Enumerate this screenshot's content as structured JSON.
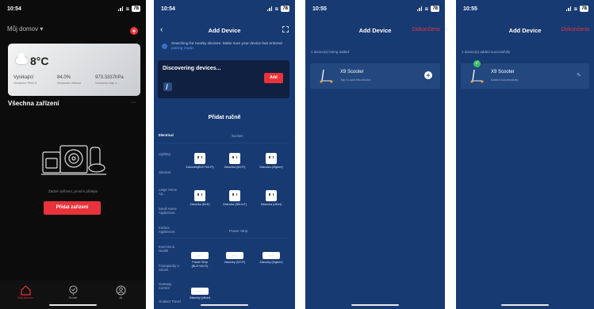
{
  "phone1": {
    "status": {
      "time": "10:54",
      "battery": "78"
    },
    "home_name": "Můj domov",
    "weather": {
      "temp": "8°C",
      "cols": [
        {
          "value": "Vynikající",
          "label": "Venkovní PM2.5"
        },
        {
          "value": "84.0%",
          "label": "Venkovní vlhkost"
        },
        {
          "value": "973.3337hPa",
          "label": "Venkovní tlak v..."
        }
      ]
    },
    "devices_title": "Všechna zařízení",
    "more": "···",
    "empty_msg": "Žádné zařízení, prosím přidejte",
    "add_button": "Přidat zařízení",
    "tabs": [
      {
        "label": "Můj domov",
        "icon": "home-icon",
        "active": true
      },
      {
        "label": "Smart",
        "icon": "smart-icon",
        "active": false
      },
      {
        "label": "Já",
        "icon": "profile-icon",
        "active": false
      }
    ]
  },
  "phone2": {
    "status": {
      "time": "10:54",
      "battery": "78"
    },
    "title": "Add Device",
    "search_msg_pre": "Searching for nearby devices. Make sure your device has entered ",
    "search_msg_link": "pairing mode.",
    "discover_title": "Discovering devices...",
    "discover_add": "Add",
    "manual_title": "Přidat ručně",
    "categories": [
      "Electrical",
      "Lighting",
      "Sensors",
      "Large Home Ap...",
      "Small Home Appliances",
      "Kitchen Appliances",
      "Exercise & Health",
      "Fotoaparáty a zámek",
      "Gateway Control",
      "Outdoor Travel"
    ],
    "section_socket": "Socket",
    "section_power_strip": "Power Strip",
    "socket_products": [
      "Zásuvka(BLE+Wi-Fi)",
      "Zásuvka (Wi-Fi)",
      "Zásuvka (Zigbee)",
      "Zásuvka (BLE)",
      "Zásuvka (NB-IoT)",
      "Zásuvka (other)"
    ],
    "strip_products": [
      "Power Strip (BLE+Wi-Fi)",
      "Zásuvky (Wi-Fi)",
      "Zásuvky (Zigbee)",
      "Zásuvky (other)"
    ]
  },
  "phone3": {
    "status": {
      "time": "10:55",
      "battery": "78"
    },
    "title": "Add Device",
    "done_link": "Dokončeno",
    "sub_msg": "1 device(s) being added",
    "device_name": "X9 Scooter",
    "device_status": "Tap to add this device"
  },
  "phone4": {
    "status": {
      "time": "10:55",
      "battery": "78"
    },
    "title": "Add Device",
    "done_link": "Dokončeno",
    "sub_msg": "1 device(s) added successfully",
    "device_name": "X9 Scooter",
    "device_status": "Added successfully"
  },
  "colors": {
    "accent_red": "#e8333b",
    "bg_blue": "#183a73",
    "card_blue": "#23477f",
    "success_green": "#3fbf6a"
  }
}
